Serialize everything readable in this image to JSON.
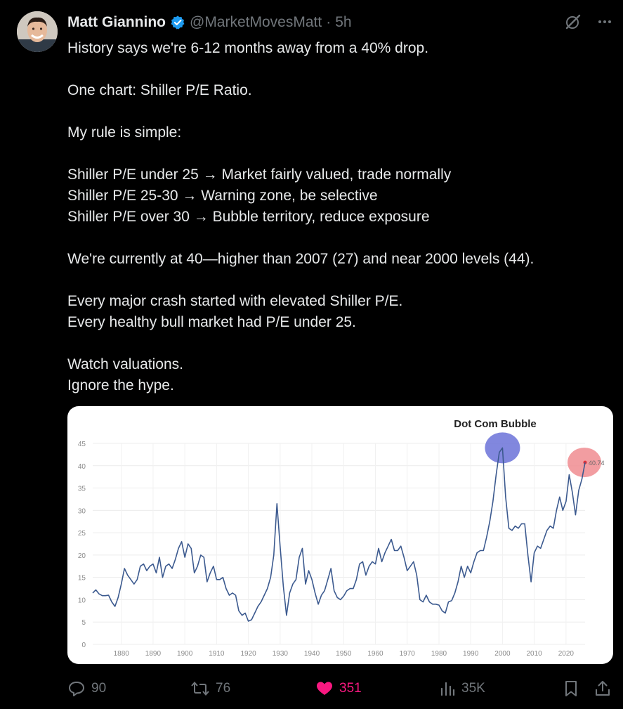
{
  "author": {
    "name": "Matt Giannino",
    "handle": "@MarketMovesMatt",
    "separator": "·",
    "time": "5h"
  },
  "icons": {
    "verified": "verified-badge-icon",
    "grok": "grok-icon",
    "more": "more-icon",
    "reply": "reply-icon",
    "repost": "repost-icon",
    "like": "heart-icon",
    "views": "views-icon",
    "bookmark": "bookmark-icon",
    "share": "share-icon"
  },
  "colors": {
    "verified": "#1d9bf0",
    "like": "#f91880",
    "muted": "#71767b",
    "chart_line": "#3c5a8f",
    "dotcom_highlight": "#6b72d8",
    "current_highlight": "#f08c90",
    "current_point": "#e0303a"
  },
  "tweet": {
    "text": "History says we're 6-12 months away from a 40% drop.\n\nOne chart: Shiller P/E Ratio.\n\nMy rule is simple:\n\nShiller P/E under 25 → Market fairly valued, trade normally\nShiller P/E 25-30 → Warning zone, be selective\nShiller P/E over 30 → Bubble territory, reduce exposure\n\nWe're currently at 40—higher than 2007 (27) and near 2000 levels (44).\n\nEvery major crash started with elevated Shiller P/E.\nEvery healthy bull market had P/E under 25.\n\nWatch valuations.\nIgnore the hype."
  },
  "actions": {
    "replies": "90",
    "reposts": "76",
    "likes": "351",
    "views": "35K"
  },
  "chart_data": {
    "type": "line",
    "annotation": "Dot Com Bubble",
    "current_label": "40.74",
    "xlim": [
      1871,
      2026
    ],
    "ylim": [
      0,
      45
    ],
    "x_ticks": [
      1880,
      1890,
      1900,
      1910,
      1920,
      1930,
      1940,
      1950,
      1960,
      1970,
      1980,
      1990,
      2000,
      2010,
      2020
    ],
    "y_ticks": [
      0,
      5,
      10,
      15,
      20,
      25,
      30,
      35,
      40,
      45
    ],
    "grid": true,
    "series": [
      {
        "points": [
          [
            1871,
            11.5
          ],
          [
            1872,
            12.2
          ],
          [
            1873,
            11.3
          ],
          [
            1874,
            10.9
          ],
          [
            1875,
            10.9
          ],
          [
            1876,
            11.0
          ],
          [
            1877,
            9.5
          ],
          [
            1878,
            8.5
          ],
          [
            1879,
            10.5
          ],
          [
            1880,
            13.5
          ],
          [
            1881,
            17.0
          ],
          [
            1882,
            15.5
          ],
          [
            1883,
            14.5
          ],
          [
            1884,
            13.5
          ],
          [
            1885,
            14.5
          ],
          [
            1886,
            17.5
          ],
          [
            1887,
            18.0
          ],
          [
            1888,
            16.5
          ],
          [
            1889,
            17.5
          ],
          [
            1890,
            18.0
          ],
          [
            1891,
            16.0
          ],
          [
            1892,
            19.5
          ],
          [
            1893,
            15.0
          ],
          [
            1894,
            17.5
          ],
          [
            1895,
            18.0
          ],
          [
            1896,
            17.0
          ],
          [
            1897,
            19.0
          ],
          [
            1898,
            21.5
          ],
          [
            1899,
            23.0
          ],
          [
            1900,
            19.5
          ],
          [
            1901,
            22.5
          ],
          [
            1902,
            21.5
          ],
          [
            1903,
            16.0
          ],
          [
            1904,
            17.5
          ],
          [
            1905,
            20.0
          ],
          [
            1906,
            19.5
          ],
          [
            1907,
            14.0
          ],
          [
            1908,
            16.0
          ],
          [
            1909,
            17.5
          ],
          [
            1910,
            14.5
          ],
          [
            1911,
            14.5
          ],
          [
            1912,
            15.0
          ],
          [
            1913,
            12.5
          ],
          [
            1914,
            11.0
          ],
          [
            1915,
            11.5
          ],
          [
            1916,
            11.0
          ],
          [
            1917,
            7.5
          ],
          [
            1918,
            6.5
          ],
          [
            1919,
            7.0
          ],
          [
            1920,
            5.2
          ],
          [
            1921,
            5.5
          ],
          [
            1922,
            7.0
          ],
          [
            1923,
            8.5
          ],
          [
            1924,
            9.5
          ],
          [
            1925,
            11.0
          ],
          [
            1926,
            12.5
          ],
          [
            1927,
            15.0
          ],
          [
            1928,
            20.0
          ],
          [
            1929,
            31.5
          ],
          [
            1930,
            22.0
          ],
          [
            1931,
            13.0
          ],
          [
            1932,
            6.5
          ],
          [
            1933,
            11.5
          ],
          [
            1934,
            13.5
          ],
          [
            1935,
            14.5
          ],
          [
            1936,
            19.5
          ],
          [
            1937,
            21.5
          ],
          [
            1938,
            13.5
          ],
          [
            1939,
            16.5
          ],
          [
            1940,
            14.5
          ],
          [
            1941,
            11.5
          ],
          [
            1942,
            9.0
          ],
          [
            1943,
            11.0
          ],
          [
            1944,
            12.0
          ],
          [
            1945,
            14.5
          ],
          [
            1946,
            17.0
          ],
          [
            1947,
            12.0
          ],
          [
            1948,
            10.5
          ],
          [
            1949,
            10.0
          ],
          [
            1950,
            10.8
          ],
          [
            1951,
            12.0
          ],
          [
            1952,
            12.5
          ],
          [
            1953,
            12.5
          ],
          [
            1954,
            14.5
          ],
          [
            1955,
            18.0
          ],
          [
            1956,
            18.5
          ],
          [
            1957,
            15.5
          ],
          [
            1958,
            17.5
          ],
          [
            1959,
            18.5
          ],
          [
            1960,
            18.0
          ],
          [
            1961,
            21.5
          ],
          [
            1962,
            18.5
          ],
          [
            1963,
            20.5
          ],
          [
            1964,
            22.0
          ],
          [
            1965,
            23.5
          ],
          [
            1966,
            21.0
          ],
          [
            1967,
            21.0
          ],
          [
            1968,
            22.0
          ],
          [
            1969,
            19.5
          ],
          [
            1970,
            16.5
          ],
          [
            1971,
            17.5
          ],
          [
            1972,
            18.5
          ],
          [
            1973,
            15.5
          ],
          [
            1974,
            10.0
          ],
          [
            1975,
            9.5
          ],
          [
            1976,
            11.0
          ],
          [
            1977,
            9.5
          ],
          [
            1978,
            9.0
          ],
          [
            1979,
            9.0
          ],
          [
            1980,
            8.8
          ],
          [
            1981,
            7.5
          ],
          [
            1982,
            7.0
          ],
          [
            1983,
            9.5
          ],
          [
            1984,
            9.8
          ],
          [
            1985,
            11.5
          ],
          [
            1986,
            14.0
          ],
          [
            1987,
            17.5
          ],
          [
            1988,
            15.0
          ],
          [
            1989,
            17.5
          ],
          [
            1990,
            16.0
          ],
          [
            1991,
            18.5
          ],
          [
            1992,
            20.5
          ],
          [
            1993,
            21.0
          ],
          [
            1994,
            21.0
          ],
          [
            1995,
            24.0
          ],
          [
            1996,
            27.5
          ],
          [
            1997,
            32.0
          ],
          [
            1998,
            38.0
          ],
          [
            1999,
            43.0
          ],
          [
            2000,
            44.0
          ],
          [
            2001,
            33.0
          ],
          [
            2002,
            26.0
          ],
          [
            2003,
            25.5
          ],
          [
            2004,
            26.5
          ],
          [
            2005,
            26.0
          ],
          [
            2006,
            27.0
          ],
          [
            2007,
            27.0
          ],
          [
            2008,
            20.0
          ],
          [
            2009,
            14.0
          ],
          [
            2010,
            20.5
          ],
          [
            2011,
            22.0
          ],
          [
            2012,
            21.5
          ],
          [
            2013,
            23.5
          ],
          [
            2014,
            25.5
          ],
          [
            2015,
            26.5
          ],
          [
            2016,
            26.0
          ],
          [
            2017,
            30.0
          ],
          [
            2018,
            33.0
          ],
          [
            2019,
            30.0
          ],
          [
            2020,
            32.0
          ],
          [
            2021,
            38.0
          ],
          [
            2022,
            34.0
          ],
          [
            2023,
            29.0
          ],
          [
            2024,
            34.5
          ],
          [
            2025,
            37.0
          ],
          [
            2026,
            40.74
          ]
        ]
      }
    ],
    "highlights": [
      {
        "label": "dot-com-peak",
        "x": 2000,
        "y": 44
      },
      {
        "label": "current",
        "x": 2026,
        "y": 40.74
      }
    ]
  }
}
